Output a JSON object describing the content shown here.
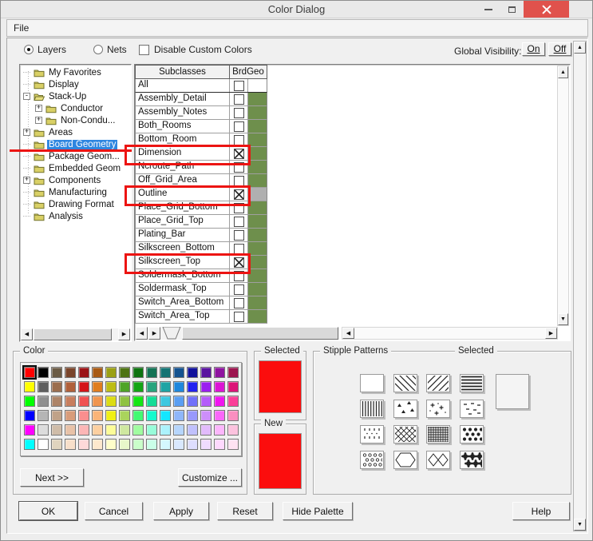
{
  "window": {
    "title": "Color Dialog"
  },
  "menu": {
    "items": [
      "File"
    ]
  },
  "controls": {
    "layers_label": "Layers",
    "nets_label": "Nets",
    "selected_mode": "Layers",
    "disable_custom_colors_label": "Disable Custom Colors",
    "disable_custom_colors_checked": false,
    "global_visibility_label": "Global Visibility:",
    "on_label": "On",
    "off_label": "Off"
  },
  "tree": {
    "items": [
      {
        "label": "My Favorites",
        "level": 1,
        "expander": null,
        "folder": "closed",
        "selected": false
      },
      {
        "label": "Display",
        "level": 1,
        "expander": null,
        "folder": "closed",
        "selected": false
      },
      {
        "label": "Stack-Up",
        "level": 1,
        "expander": "minus",
        "folder": "open",
        "selected": false
      },
      {
        "label": "Conductor",
        "level": 2,
        "expander": "plus",
        "folder": "closed",
        "selected": false
      },
      {
        "label": "Non-Condu...",
        "level": 2,
        "expander": "plus",
        "folder": "closed",
        "selected": false
      },
      {
        "label": "Areas",
        "level": 1,
        "expander": "plus",
        "folder": "closed",
        "selected": false
      },
      {
        "label": "Board Geometry",
        "level": 1,
        "expander": null,
        "folder": "closed",
        "selected": true
      },
      {
        "label": "Package Geom...",
        "level": 1,
        "expander": null,
        "folder": "closed",
        "selected": false
      },
      {
        "label": "Embedded Geom",
        "level": 1,
        "expander": null,
        "folder": "closed",
        "selected": false
      },
      {
        "label": "Components",
        "level": 1,
        "expander": "plus",
        "folder": "closed",
        "selected": false
      },
      {
        "label": "Manufacturing",
        "level": 1,
        "expander": null,
        "folder": "closed",
        "selected": false
      },
      {
        "label": "Drawing Format",
        "level": 1,
        "expander": null,
        "folder": "closed",
        "selected": false
      },
      {
        "label": "Analysis",
        "level": 1,
        "expander": null,
        "folder": "closed",
        "selected": false
      }
    ]
  },
  "subclass_table": {
    "columns": [
      "Subclasses",
      "BrdGeo"
    ],
    "default_chip_color": "#6E8F4C",
    "rows": [
      {
        "name": "All",
        "checked": false,
        "chip": "#FFFFFF",
        "annotated": false
      },
      {
        "name": "Assembly_Detail",
        "checked": false,
        "annotated": false
      },
      {
        "name": "Assembly_Notes",
        "checked": false,
        "annotated": false
      },
      {
        "name": "Both_Rooms",
        "checked": false,
        "annotated": false
      },
      {
        "name": "Bottom_Room",
        "checked": false,
        "annotated": false
      },
      {
        "name": "Dimension",
        "checked": true,
        "annotated": true
      },
      {
        "name": "Ncroute_Path",
        "checked": false,
        "annotated": false
      },
      {
        "name": "Off_Grid_Area",
        "checked": false,
        "annotated": false
      },
      {
        "name": "Outline",
        "checked": true,
        "chip": "#B0B0B0",
        "annotated": true
      },
      {
        "name": "Place_Grid_Bottom",
        "checked": false,
        "annotated": false
      },
      {
        "name": "Place_Grid_Top",
        "checked": false,
        "annotated": false
      },
      {
        "name": "Plating_Bar",
        "checked": false,
        "annotated": false
      },
      {
        "name": "Silkscreen_Bottom",
        "checked": false,
        "annotated": false
      },
      {
        "name": "Silkscreen_Top",
        "checked": true,
        "annotated": true
      },
      {
        "name": "Soldermask_Bottom",
        "checked": false,
        "annotated": false
      },
      {
        "name": "Soldermask_Top",
        "checked": false,
        "annotated": false
      },
      {
        "name": "Switch_Area_Bottom",
        "checked": false,
        "annotated": false
      },
      {
        "name": "Switch_Area_Top",
        "checked": false,
        "annotated": false
      }
    ]
  },
  "color_section": {
    "label": "Color",
    "next_label": "Next >>",
    "customize_label": "Customize ...",
    "selected_palette_cell": [
      0,
      0
    ],
    "palette": [
      [
        "#FF0000",
        "#000000",
        "#6B5B45",
        "#7A452B",
        "#9B1417",
        "#A85A14",
        "#9BA014",
        "#4E7314",
        "#0E7310",
        "#147355",
        "#147373",
        "#14528F",
        "#12129B",
        "#5A14A0",
        "#8F14A0",
        "#9B144E"
      ],
      [
        "#FFFF00",
        "#5E5E5E",
        "#9B6E4E",
        "#B0603A",
        "#D41418",
        "#E07D1E",
        "#BDBD14",
        "#4EA428",
        "#14A414",
        "#28A47D",
        "#1EA4A4",
        "#1E87DC",
        "#2020F0",
        "#9B1EF0",
        "#DC14D4",
        "#DC1478"
      ],
      [
        "#00FF00",
        "#8F8F8F",
        "#AD8468",
        "#C87E5E",
        "#F05252",
        "#F0954E",
        "#DCDC14",
        "#8FC242",
        "#14E614",
        "#14DC96",
        "#3DC8E0",
        "#5A9EF2",
        "#7070FA",
        "#B45CFA",
        "#F014F0",
        "#FA3E98"
      ],
      [
        "#0000FF",
        "#B5B5B5",
        "#C0A288",
        "#D89C7A",
        "#FA8E8E",
        "#FAB478",
        "#F0F014",
        "#AAD45C",
        "#42FA72",
        "#14FACD",
        "#14E6FF",
        "#8EB6FA",
        "#9898FC",
        "#CD8EFA",
        "#FA66FA",
        "#FA8EC0"
      ],
      [
        "#FF00FF",
        "#DCDCDC",
        "#CFBCA8",
        "#E8C2A8",
        "#FCB6B6",
        "#FCCFA0",
        "#FCFC98",
        "#CFE8A0",
        "#A0FCA0",
        "#98FCD9",
        "#ACF2FC",
        "#B6D5FC",
        "#C0C0FC",
        "#E2BBFC",
        "#FCB6FC",
        "#FCC2DE"
      ],
      [
        "#00FFFF",
        "#FFFFFF",
        "#E0D4BE",
        "#F7DFCA",
        "#FED9D9",
        "#FDE8CD",
        "#FEFECA",
        "#E8F7CA",
        "#CAFECA",
        "#CAFEE8",
        "#D4F7FE",
        "#D9E8FE",
        "#DEDEFE",
        "#F0DBFE",
        "#FED9FE",
        "#FEE2F2"
      ]
    ]
  },
  "selected_color": {
    "label": "Selected",
    "color": "#FB0D0D"
  },
  "new_color": {
    "label": "New",
    "color": "#FB0D0D"
  },
  "stipple": {
    "label": "Stipple Patterns",
    "selected_label": "Selected",
    "selected_pattern": "none",
    "patterns": [
      "solid",
      "diagonal-lines-down",
      "diagonal-lines-up",
      "horizontal-lines",
      "vertical-lines",
      "scattered-triangles",
      "scattered-plus",
      "scattered-dashes",
      "dotted-columns",
      "diamond-mesh",
      "dense-grid",
      "polka-dots",
      "small-rings",
      "octagon-outline",
      "double-diamond",
      "heavy-clusters"
    ]
  },
  "footer": {
    "buttons": [
      "OK",
      "Cancel",
      "Apply",
      "Reset",
      "Hide Palette"
    ],
    "help_label": "Help"
  },
  "annotation": {
    "color": "#EC1412",
    "highlighted_rows": [
      "Dimension",
      "Outline",
      "Silkscreen_Top"
    ],
    "highlighted_tree_item": "Board Geometry"
  }
}
